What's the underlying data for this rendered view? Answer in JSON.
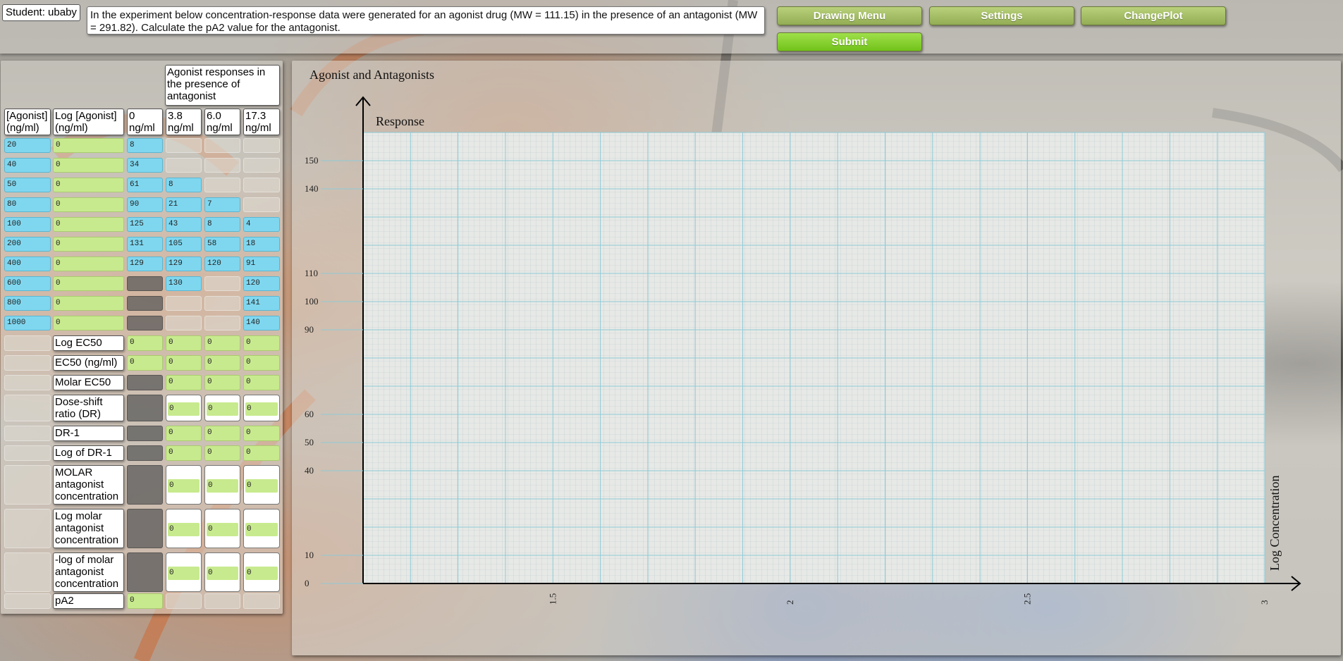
{
  "student": {
    "label": "Student: ubaby"
  },
  "question": {
    "text": "In the experiment below concentration-response data were generated for an agonist drug (MW = 111.15) in the presence of an antagonist (MW = 291.82). Calculate the pA2 value for the antagonist."
  },
  "toolbar": {
    "drawing_menu": "Drawing Menu",
    "settings": "Settings",
    "change_plot": "ChangePlot",
    "submit": "Submit"
  },
  "table": {
    "group_header": "Agonist responses in the presence of antagonist",
    "col_agonist": "[Agonist] (ng/ml)",
    "col_log_agonist": "Log [Agonist] (ng/ml)",
    "antagonist_cols": [
      "0 ng/ml",
      "3.8 ng/ml",
      "6.0 ng/ml",
      "17.3 ng/ml"
    ],
    "rows": [
      {
        "agonist": "20",
        "log": "0",
        "r": [
          "8",
          "",
          "",
          ""
        ]
      },
      {
        "agonist": "40",
        "log": "0",
        "r": [
          "34",
          "",
          "",
          ""
        ]
      },
      {
        "agonist": "50",
        "log": "0",
        "r": [
          "61",
          "8",
          "",
          ""
        ]
      },
      {
        "agonist": "80",
        "log": "0",
        "r": [
          "90",
          "21",
          "7",
          ""
        ]
      },
      {
        "agonist": "100",
        "log": "0",
        "r": [
          "125",
          "43",
          "8",
          "4"
        ]
      },
      {
        "agonist": "200",
        "log": "0",
        "r": [
          "131",
          "105",
          "58",
          "18"
        ]
      },
      {
        "agonist": "400",
        "log": "0",
        "r": [
          "129",
          "129",
          "120",
          "91"
        ]
      },
      {
        "agonist": "600",
        "log": "0",
        "r": [
          "",
          "130",
          "",
          "120"
        ]
      },
      {
        "agonist": "800",
        "log": "0",
        "r": [
          "",
          "",
          "",
          "141"
        ]
      },
      {
        "agonist": "1000",
        "log": "0",
        "r": [
          "",
          "",
          "",
          "140"
        ]
      }
    ],
    "calc": [
      {
        "label": "Log EC50",
        "vals": [
          "0",
          "0",
          "0",
          "0"
        ]
      },
      {
        "label": "EC50 (ng/ml)",
        "vals": [
          "0",
          "0",
          "0",
          "0"
        ]
      },
      {
        "label": "Molar EC50",
        "vals": [
          null,
          "0",
          "0",
          "0"
        ]
      },
      {
        "label": "Dose-shift ratio (DR)",
        "vals": [
          null,
          "0",
          "0",
          "0"
        ]
      },
      {
        "label": "DR-1",
        "vals": [
          null,
          "0",
          "0",
          "0"
        ]
      },
      {
        "label": "Log of DR-1",
        "vals": [
          null,
          "0",
          "0",
          "0"
        ]
      },
      {
        "label": "MOLAR antagonist concentration",
        "vals": [
          null,
          "0",
          "0",
          "0"
        ]
      },
      {
        "label": "Log molar antagonist concentration",
        "vals": [
          null,
          "0",
          "0",
          "0"
        ]
      },
      {
        "label": "-log of molar antagonist concentration",
        "vals": [
          null,
          "0",
          "0",
          "0"
        ]
      },
      {
        "label": "pA2",
        "vals": [
          "0",
          null,
          null,
          null
        ]
      }
    ]
  },
  "chart_data": {
    "type": "scatter",
    "title": "Agonist and Antagonists",
    "ylabel": "Response",
    "xlabel": "Log Concentration",
    "ylim": [
      0,
      160
    ],
    "xlim": [
      1.1,
      3.0
    ],
    "y_ticks": [
      0,
      10,
      40,
      50,
      60,
      90,
      100,
      110,
      140,
      150
    ],
    "x_ticks": [
      1.5,
      2,
      2.5,
      3
    ],
    "x_tick_labels": [
      "1.5",
      "2",
      "2.5",
      "3"
    ],
    "grid": true,
    "series": []
  }
}
